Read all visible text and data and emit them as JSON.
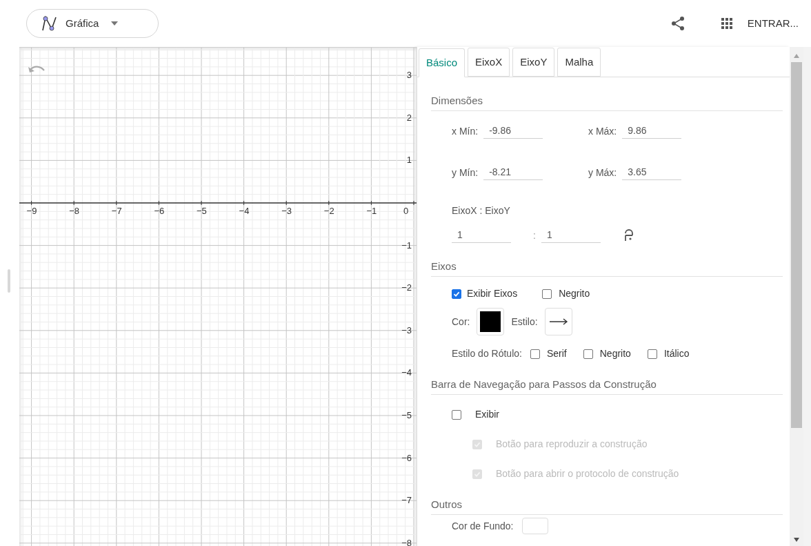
{
  "toolbar": {
    "app_menu": {
      "label": "Gráfica"
    },
    "sign_in": "ENTRAR..."
  },
  "graphics": {
    "x_labels": [
      "−9",
      "−8",
      "−7",
      "−6",
      "−5",
      "−4",
      "−3",
      "−2",
      "−1",
      "0"
    ],
    "y_labels": [
      "3",
      "2",
      "1",
      "−1",
      "−2",
      "−3",
      "−4",
      "−5",
      "−6",
      "−7",
      "−8"
    ]
  },
  "settings": {
    "tabs": [
      {
        "label": "Básico",
        "selected": true
      },
      {
        "label": "EixoX",
        "selected": false
      },
      {
        "label": "EixoY",
        "selected": false
      },
      {
        "label": "Malha",
        "selected": false
      }
    ],
    "dimensions": {
      "title": "Dimensões",
      "fields": [
        {
          "label": "x Mín:",
          "value": "-9.86"
        },
        {
          "label": "x Máx:",
          "value": "9.86"
        },
        {
          "label": "y Mín:",
          "value": "-8.21"
        },
        {
          "label": "y Máx:",
          "value": "3.65"
        }
      ],
      "ratio_label": "EixoX : EixoY",
      "ratio": [
        "1",
        "1"
      ],
      "ratio_separator": ":",
      "locked": false
    },
    "axes": {
      "title": "Eixos",
      "show_axes": {
        "label": "Exibir Eixos",
        "checked": true
      },
      "bold": {
        "label": "Negrito",
        "checked": false
      },
      "color_label": "Cor:",
      "color": "#000000",
      "style_label": "Estilo:",
      "label_style": {
        "label": "Estilo do Rótulo:",
        "options": [
          {
            "label": "Serif",
            "checked": false
          },
          {
            "label": "Negrito",
            "checked": false
          },
          {
            "label": "Itálico",
            "checked": false
          }
        ]
      }
    },
    "navigation": {
      "title": "Barra de Navegação para Passos da Construção",
      "show": {
        "label": "Exibir",
        "checked": false
      },
      "options": [
        {
          "label": "Botão para reproduzir a construção",
          "checked": true,
          "disabled": true
        },
        {
          "label": "Botão para abrir o protocolo de construção",
          "checked": true,
          "disabled": true
        }
      ]
    },
    "others": {
      "title": "Outros",
      "background_label": "Cor de Fundo:"
    }
  }
}
